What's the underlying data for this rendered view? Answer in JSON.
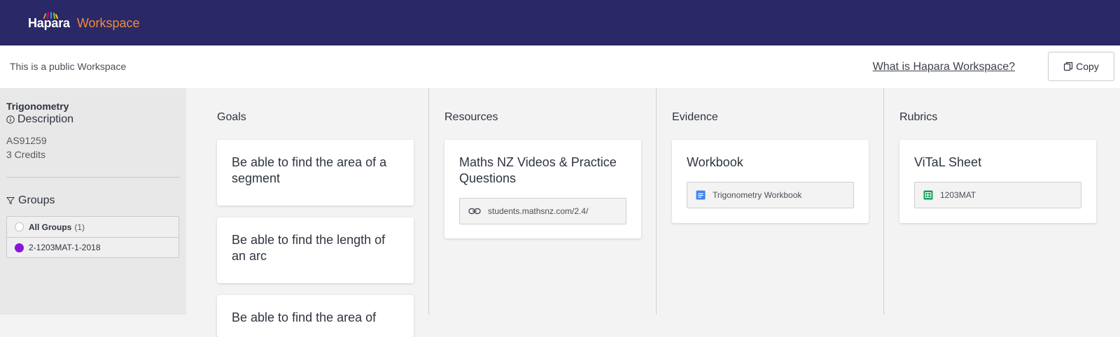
{
  "header": {
    "logo_main": "Hapara",
    "logo_sub": "Workspace",
    "colors": {
      "bar": "#2a2867",
      "accent": "#ef8b3a"
    }
  },
  "publicbar": {
    "text": "This is a public Workspace",
    "help_link": "What is Hapara Workspace?",
    "copy_label": "Copy"
  },
  "sidebar": {
    "title": "Trigonometry",
    "description_label": "Description",
    "meta": [
      "AS91259",
      "3 Credits"
    ],
    "groups_label": "Groups",
    "groups": [
      {
        "name": "All Groups",
        "count": "(1)",
        "color": "",
        "icon": "radio-empty"
      },
      {
        "name": "2-1203MAT-1-2018",
        "count": "",
        "color": "#8a16d8",
        "icon": "radio-filled"
      }
    ]
  },
  "columns": {
    "goals": {
      "title": "Goals",
      "cards": [
        {
          "title": "Be able to find the area of a segment"
        },
        {
          "title": "Be able to find the length of an arc"
        },
        {
          "title": "Be able to find the area of"
        }
      ]
    },
    "resources": {
      "title": "Resources",
      "cards": [
        {
          "title": "Maths NZ Videos & Practice Questions",
          "attachment": "students.mathsnz.com/2.4/",
          "icon": "link-icon"
        }
      ]
    },
    "evidence": {
      "title": "Evidence",
      "cards": [
        {
          "title": "Workbook",
          "attachment": "Trigonometry Workbook",
          "icon": "google-docs-icon"
        }
      ]
    },
    "rubrics": {
      "title": "Rubrics",
      "cards": [
        {
          "title": "ViTaL Sheet",
          "attachment": "1203MAT",
          "icon": "google-sheets-icon"
        }
      ]
    }
  }
}
